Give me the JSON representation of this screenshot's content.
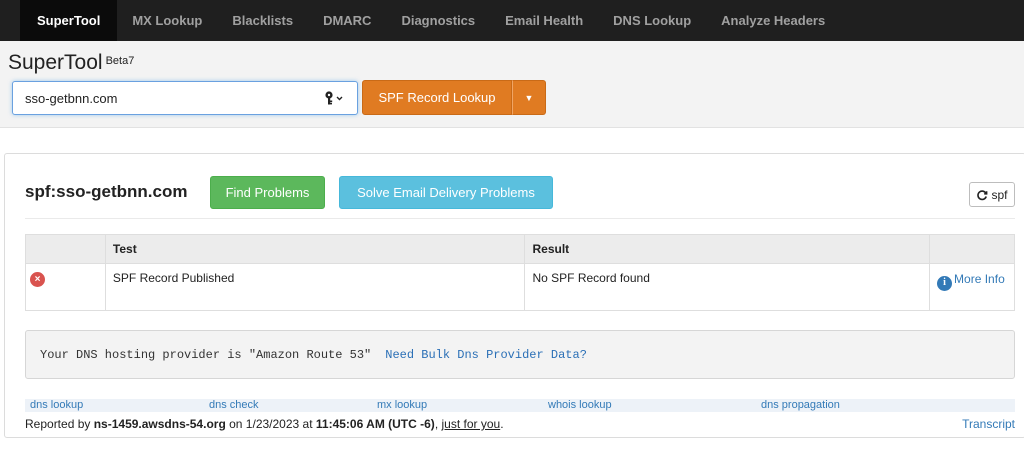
{
  "nav": {
    "items": [
      {
        "label": "SuperTool",
        "active": true
      },
      {
        "label": "MX Lookup"
      },
      {
        "label": "Blacklists"
      },
      {
        "label": "DMARC"
      },
      {
        "label": "Diagnostics"
      },
      {
        "label": "Email Health"
      },
      {
        "label": "DNS Lookup"
      },
      {
        "label": "Analyze Headers"
      }
    ]
  },
  "header": {
    "brand": "SuperTool",
    "badge": "Beta7",
    "search_value": "sso-getbnn.com",
    "key_icon": "key-icon",
    "lookup_button": "SPF Record Lookup",
    "colors": {
      "accent": "#e07b22",
      "nav_bg": "#1f1f1f"
    }
  },
  "panel": {
    "title": "spf:sso-getbnn.com",
    "find_problems": "Find Problems",
    "solve_delivery": "Solve Email Delivery Problems",
    "refresh_label": "spf",
    "table": {
      "headers": [
        "",
        "Test",
        "Result",
        ""
      ],
      "rows": [
        {
          "status": "error",
          "status_glyph": "×",
          "test": "SPF Record Published",
          "result": "No SPF Record found",
          "more_info": "More Info"
        }
      ]
    },
    "dns_notice": {
      "text": "Your DNS hosting provider is \"Amazon Route 53\"",
      "link": "Need Bulk Dns Provider Data?"
    },
    "quick_links": [
      "dns lookup",
      "dns check",
      "mx lookup",
      "whois lookup",
      "dns propagation"
    ],
    "report": {
      "prefix": "Reported by",
      "server": "ns-1459.awsdns-54.org",
      "on": "on 1/23/2023 at",
      "time": "11:45:06 AM (UTC -6)",
      "comma": ",",
      "just_for_you": "just for you",
      "period": ".",
      "transcript": "Transcript"
    }
  }
}
